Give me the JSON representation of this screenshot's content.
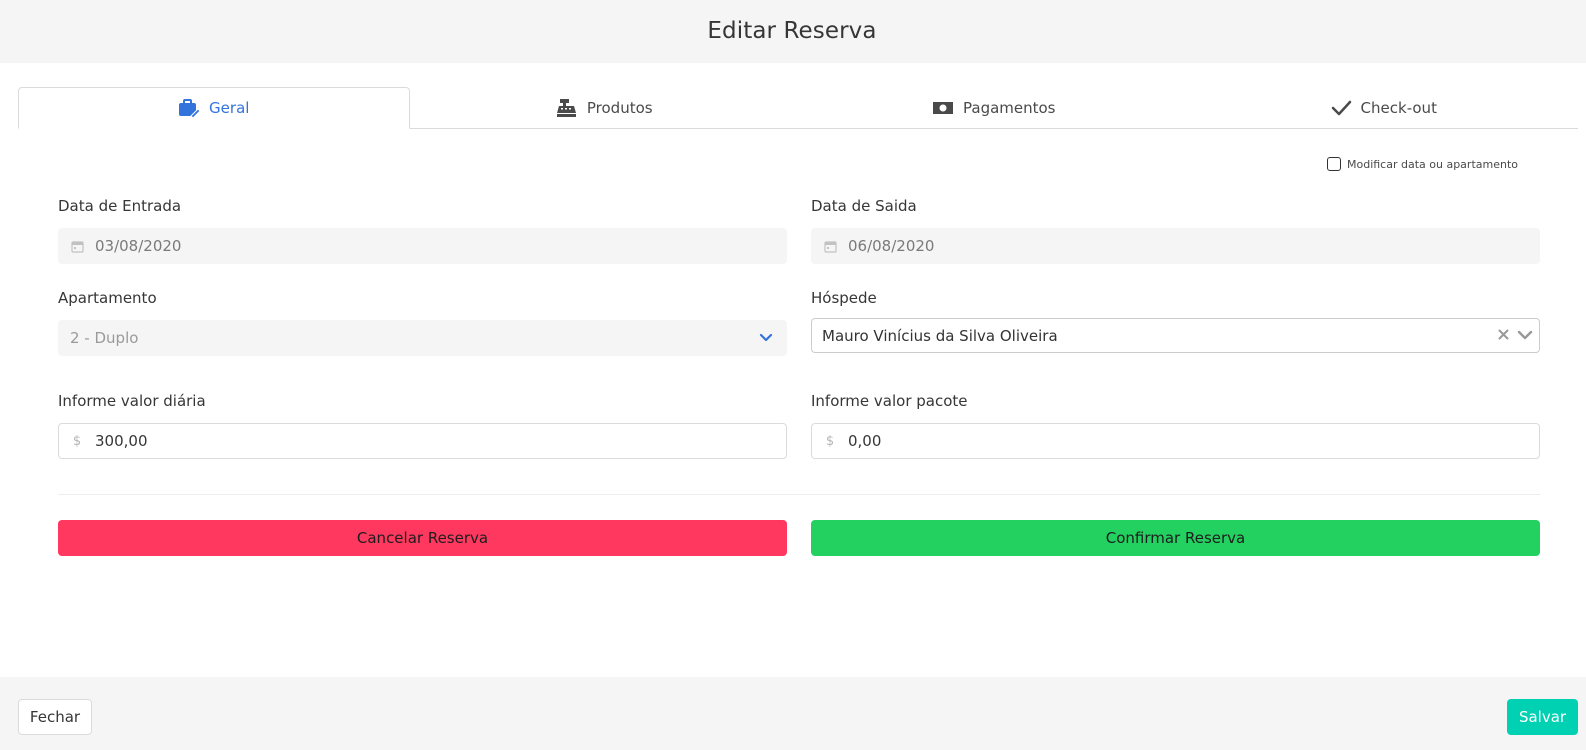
{
  "header": {
    "title": "Editar Reserva"
  },
  "tabs": [
    {
      "label": "Geral",
      "icon": "briefcase-edit-icon",
      "active": true
    },
    {
      "label": "Produtos",
      "icon": "cash-register-icon",
      "active": false
    },
    {
      "label": "Pagamentos",
      "icon": "money-bill-icon",
      "active": false
    },
    {
      "label": "Check-out",
      "icon": "check-icon",
      "active": false
    }
  ],
  "modify_checkbox": {
    "label": "Modificar data ou apartamento",
    "checked": false
  },
  "form": {
    "check_in": {
      "label": "Data de Entrada",
      "value": "03/08/2020",
      "icon": "calendar-icon"
    },
    "check_out": {
      "label": "Data de Saida",
      "value": "06/08/2020",
      "icon": "calendar-icon"
    },
    "apartment": {
      "label": "Apartamento",
      "value": "2 - Duplo"
    },
    "guest": {
      "label": "Hóspede",
      "value": "Mauro Vinícius da Silva Oliveira"
    },
    "daily_rate": {
      "label": "Informe valor diária",
      "value": "300,00",
      "prefix": "$"
    },
    "package_rate": {
      "label": "Informe valor pacote",
      "value": "0,00",
      "prefix": "$"
    }
  },
  "actions": {
    "cancel_label": "Cancelar Reserva",
    "confirm_label": "Confirmar Reserva"
  },
  "footer": {
    "close_label": "Fechar",
    "save_label": "Salvar"
  },
  "colors": {
    "accent": "#3273dc",
    "cancel": "#ff3860",
    "confirm": "#23d160",
    "save": "#00d1b2"
  }
}
